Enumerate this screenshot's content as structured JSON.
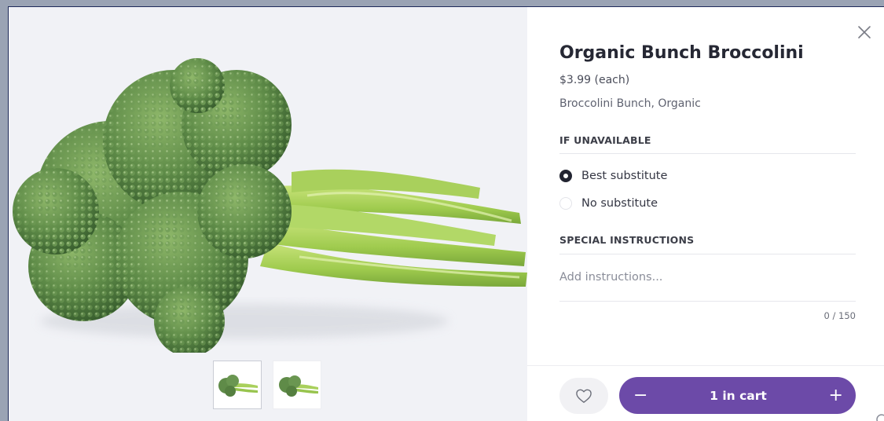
{
  "product": {
    "title": "Organic Bunch Broccolini",
    "price": "$3.99 (each)",
    "subtitle": "Broccolini Bunch, Organic",
    "image_icon": "broccolini-image"
  },
  "if_unavailable": {
    "heading": "IF UNAVAILABLE",
    "options": [
      {
        "label": "Best substitute",
        "selected": true
      },
      {
        "label": "No substitute",
        "selected": false
      }
    ]
  },
  "special_instructions": {
    "heading": "SPECIAL INSTRUCTIONS",
    "placeholder": "Add instructions...",
    "value": "",
    "counter": "0 / 150"
  },
  "cart": {
    "label": "1 in cart",
    "minus": "−",
    "plus": "+"
  },
  "colors": {
    "accent": "#6c4aa8",
    "image_bg": "#f1f2f6",
    "title": "#262834"
  },
  "icons": {
    "close": "close-icon",
    "favorite": "heart-icon"
  }
}
